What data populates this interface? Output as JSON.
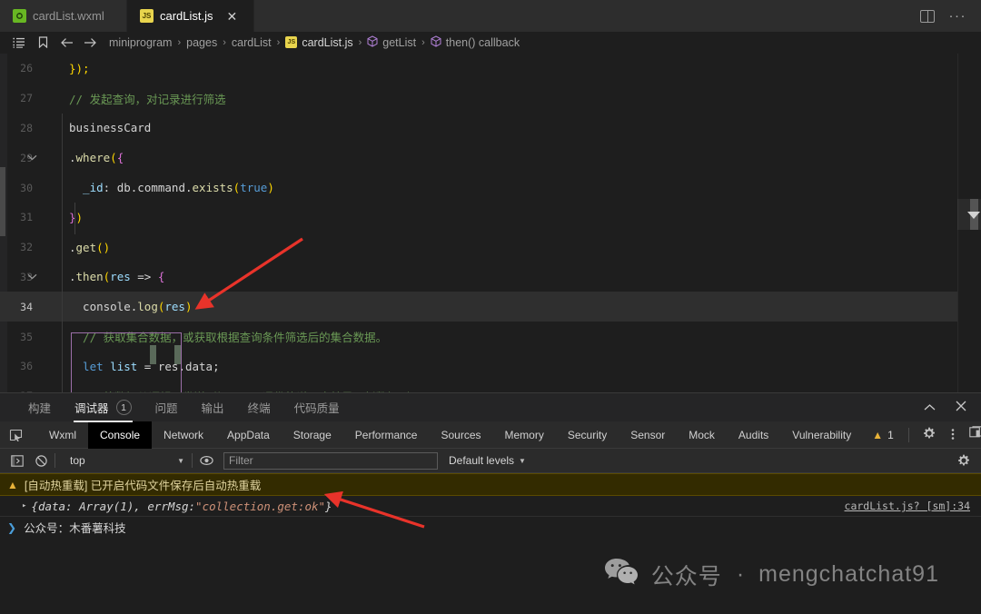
{
  "window": {
    "split_editor_label": "Split Editor",
    "more_actions_label": "···"
  },
  "tabs": [
    {
      "name": "cardList.wxml",
      "icon": "wxml-file-icon",
      "icon_text": "W",
      "active": false
    },
    {
      "name": "cardList.js",
      "icon": "js-file-icon",
      "icon_text": "JS",
      "active": true
    }
  ],
  "breadcrumb": {
    "icons": [
      "outline-list-icon",
      "bookmark-icon",
      "arrow-left-icon",
      "arrow-right-icon"
    ],
    "segments": [
      {
        "label": "miniprogram",
        "icon": ""
      },
      {
        "label": "pages",
        "icon": ""
      },
      {
        "label": "cardList",
        "icon": ""
      },
      {
        "label": "cardList.js",
        "icon": "js-file-icon"
      },
      {
        "label": "getList",
        "icon": "symbol-method-icon"
      },
      {
        "label": "then() callback",
        "icon": "symbol-method-icon"
      }
    ],
    "separator": "›"
  },
  "editor": {
    "highlight_line": 34,
    "lines": [
      {
        "num": "26",
        "fold": "",
        "tokens": [
          {
            "t": "});",
            "c": "tk-br-y"
          }
        ]
      },
      {
        "num": "27",
        "fold": "",
        "tokens": [
          {
            "t": "// 发起查询，对记录进行筛选",
            "c": "tk-comm"
          }
        ]
      },
      {
        "num": "28",
        "fold": "",
        "tokens": [
          {
            "t": "businessCard",
            "c": "tk-plain"
          }
        ]
      },
      {
        "num": "29",
        "fold": "chevron-down",
        "tokens": [
          {
            "t": ".",
            "c": "tk-dot"
          },
          {
            "t": "where",
            "c": "tk-prop"
          },
          {
            "t": "(",
            "c": "tk-br-y"
          },
          {
            "t": "{",
            "c": "tk-br-p"
          }
        ]
      },
      {
        "num": "30",
        "fold": "",
        "tokens": [
          {
            "t": "  _id",
            "c": "tk-var"
          },
          {
            "t": ": ",
            "c": "tk-plain"
          },
          {
            "t": "db",
            "c": "tk-plain"
          },
          {
            "t": ".",
            "c": "tk-dot"
          },
          {
            "t": "command",
            "c": "tk-plain"
          },
          {
            "t": ".",
            "c": "tk-dot"
          },
          {
            "t": "exists",
            "c": "tk-prop"
          },
          {
            "t": "(",
            "c": "tk-br-y"
          },
          {
            "t": "true",
            "c": "tk-key"
          },
          {
            "t": ")",
            "c": "tk-br-y"
          }
        ]
      },
      {
        "num": "31",
        "fold": "",
        "tokens": [
          {
            "t": "}",
            "c": "tk-br-p"
          },
          {
            "t": ")",
            "c": "tk-br-y"
          }
        ]
      },
      {
        "num": "32",
        "fold": "",
        "tokens": [
          {
            "t": ".",
            "c": "tk-dot"
          },
          {
            "t": "get",
            "c": "tk-prop"
          },
          {
            "t": "()",
            "c": "tk-br-y"
          }
        ]
      },
      {
        "num": "33",
        "fold": "chevron-down",
        "tokens": [
          {
            "t": ".",
            "c": "tk-dot"
          },
          {
            "t": "then",
            "c": "tk-prop"
          },
          {
            "t": "(",
            "c": "tk-br-y"
          },
          {
            "t": "res",
            "c": "tk-var"
          },
          {
            "t": " => ",
            "c": "tk-plain"
          },
          {
            "t": "{",
            "c": "tk-br-p"
          }
        ]
      },
      {
        "num": "34",
        "fold": "",
        "tokens": [
          {
            "t": "  console",
            "c": "tk-plain"
          },
          {
            "t": ".",
            "c": "tk-dot"
          },
          {
            "t": "log",
            "c": "tk-prop"
          },
          {
            "t": "(",
            "c": "tk-br-y"
          },
          {
            "t": "res",
            "c": "tk-var"
          },
          {
            "t": ")",
            "c": "tk-br-y"
          }
        ]
      },
      {
        "num": "35",
        "fold": "",
        "tokens": [
          {
            "t": "  // 获取集合数据，或获取根据查询条件筛选后的集合数据。",
            "c": "tk-comm"
          }
        ]
      },
      {
        "num": "36",
        "fold": "",
        "tokens": [
          {
            "t": "  let",
            "c": "tk-let"
          },
          {
            "t": " list",
            "c": "tk-var"
          },
          {
            "t": " = ",
            "c": "tk-plain"
          },
          {
            "t": "res",
            "c": "tk-plain"
          },
          {
            "t": ".",
            "c": "tk-dot"
          },
          {
            "t": "data",
            "c": "tk-plain"
          },
          {
            "t": ";",
            "c": "tk-plain"
          }
        ]
      },
      {
        "num": "37",
        "fold": "",
        "tokens": [
          {
            "t": "  // 将数据从逻辑层发送到视图层，通俗的说，也就是更新数据到页面展示",
            "c": "tk-comm"
          }
        ]
      }
    ]
  },
  "panel": {
    "tabs": [
      {
        "label": "构建",
        "badge": "",
        "active": false
      },
      {
        "label": "调试器",
        "badge": "1",
        "active": true
      },
      {
        "label": "问题",
        "badge": "",
        "active": false
      },
      {
        "label": "输出",
        "badge": "",
        "active": false
      },
      {
        "label": "终端",
        "badge": "",
        "active": false
      },
      {
        "label": "代码质量",
        "badge": "",
        "active": false
      }
    ],
    "collapse_icon": "chevron-up-icon",
    "close_icon": "close-icon"
  },
  "devtools": {
    "inspect_icon": "inspect-element-icon",
    "tabs": [
      {
        "label": "Wxml",
        "active": false
      },
      {
        "label": "Console",
        "active": true
      },
      {
        "label": "Network",
        "active": false
      },
      {
        "label": "AppData",
        "active": false
      },
      {
        "label": "Storage",
        "active": false
      },
      {
        "label": "Performance",
        "active": false
      },
      {
        "label": "Sources",
        "active": false
      },
      {
        "label": "Memory",
        "active": false
      },
      {
        "label": "Security",
        "active": false
      },
      {
        "label": "Sensor",
        "active": false
      },
      {
        "label": "Mock",
        "active": false
      },
      {
        "label": "Audits",
        "active": false
      },
      {
        "label": "Vulnerability",
        "active": false
      }
    ],
    "warning_count": "1",
    "warning_icon": "warning-triangle-icon",
    "settings_icon": "gear-icon",
    "more_icon": "kebab-menu-icon",
    "dock_icon": "dock-position-icon"
  },
  "console_toolbar": {
    "clear_console_icon": "clear-console-icon",
    "no_entry_icon": "no-entry-icon",
    "context_value": "top",
    "eye_icon": "live-expression-icon",
    "filter_placeholder": "Filter",
    "filter_value": "",
    "levels_label": "Default levels",
    "settings_icon": "gear-icon"
  },
  "console_messages": [
    {
      "type": "warning",
      "icon": "warning-triangle-icon",
      "text": "[自动热重载] 已开启代码文件保存后自动热重载",
      "source": ""
    },
    {
      "type": "log",
      "disclosure": "▸",
      "text_prefix": "{data: Array(1), errMsg: ",
      "text_string": "\"collection.get:ok\"",
      "text_suffix": "}",
      "source": "cardList.js? [sm]:34"
    },
    {
      "type": "prompt",
      "arrow": "❯",
      "text": "公众号：木番薯科技",
      "source": ""
    }
  ],
  "watermark": {
    "icon": "wechat-icon",
    "label": "公众号",
    "separator": "·",
    "handle": "mengchatchat91"
  },
  "colors": {
    "editor_bg": "#1e1e1e",
    "tab_bg": "#2d2d2d",
    "panel_bg": "#252526",
    "accent_js": "#e8d44d",
    "accent_wxml": "#68b723",
    "warning": "#e8b339",
    "annotation_arrow": "#e8332a",
    "string": "#ce9178",
    "comment": "#6a9955"
  }
}
